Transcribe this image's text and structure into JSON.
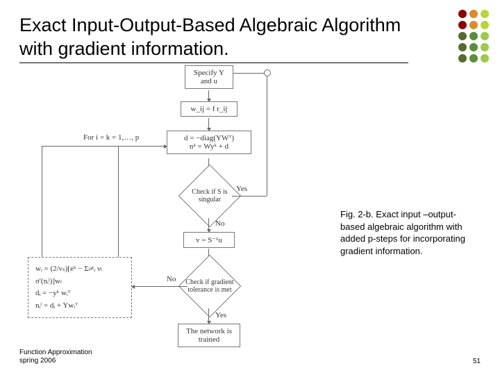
{
  "title": "Exact Input-Output-Based Algebraic Algorithm with gradient information.",
  "dots_pattern": [
    "c1",
    "c2",
    "c3",
    "c1",
    "c2",
    "c3",
    "c4",
    "c5",
    "c6",
    "c4",
    "c5",
    "c6",
    "c4",
    "c5",
    "c6"
  ],
  "flow": {
    "specify": "Specify Y\nand u",
    "w_eq": "w_ij = f r_ij",
    "d_eq": "d = −diag(YWᵀ)\nnᵏ = Wyᵏ + d",
    "check_singular": "Check if S is singular",
    "v_eq": "v = S⁻¹u",
    "check_grad": "Check if gradient tolerance is met",
    "trained": "The network is trained",
    "for_label": "For i = k = 1,…, p",
    "yes": "Yes",
    "no": "No",
    "no2": "No",
    "yes2": "Yes",
    "sideloop": {
      "w_line": "wᵢ = (2/νₛ)[eᵏ − Σₗ≠ᵢ νₗ σ'(nᵢˡ)]wₗ",
      "d_line": "dᵢ = −yᵏ wᵢᵀ",
      "n_line": "nᵢˡ = dᵢ + Ywᵢᵀ"
    }
  },
  "caption": "Fig. 2-b. Exact input –output-based algebraic algorithm with added p-steps for incorporating gradient information.",
  "footer_left": "Function Approximation\nspring 2006",
  "footer_right": "51"
}
